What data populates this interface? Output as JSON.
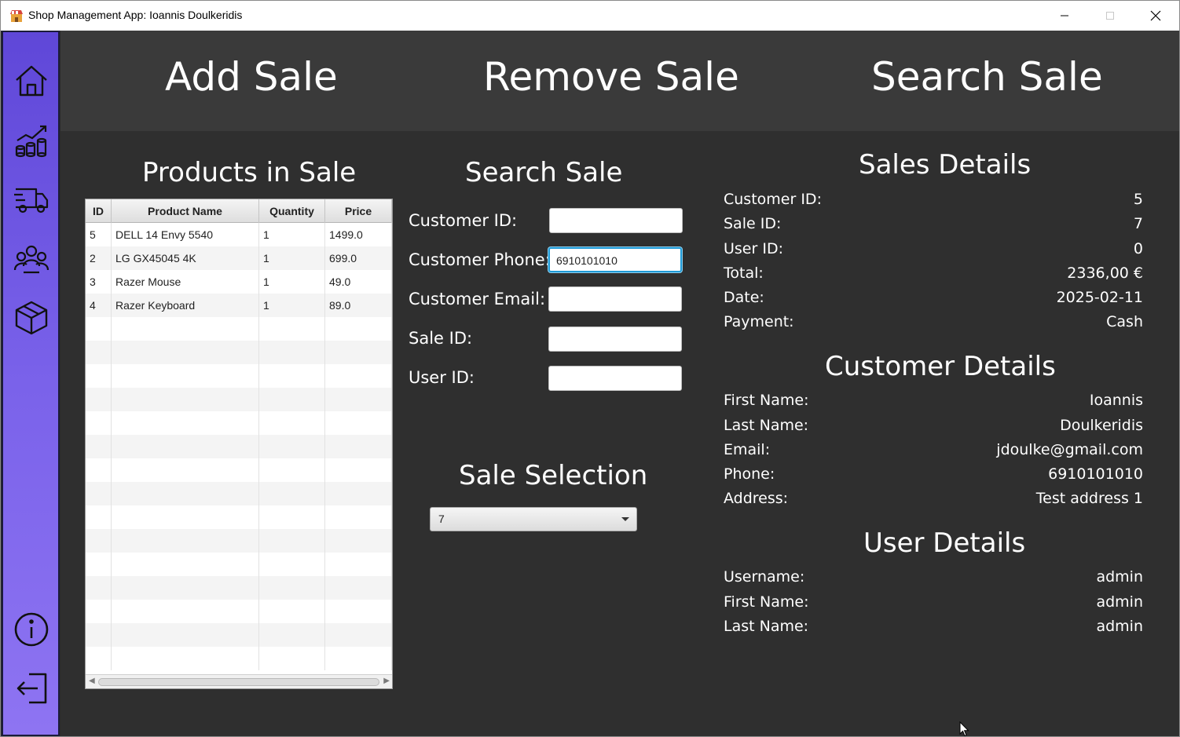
{
  "window": {
    "title": "Shop Management App: Ioannis Doulkeridis"
  },
  "sidebar": {
    "items": [
      {
        "icon": "home-icon"
      },
      {
        "icon": "sales-chart-icon"
      },
      {
        "icon": "delivery-truck-icon"
      },
      {
        "icon": "customers-icon"
      },
      {
        "icon": "products-box-icon"
      },
      {
        "icon": "info-icon"
      },
      {
        "icon": "logout-icon"
      }
    ],
    "accent_top": "#5f47d8",
    "accent_bottom": "#8e74f2"
  },
  "header": {
    "add_sale": "Add Sale",
    "remove_sale": "Remove Sale",
    "search_sale": "Search Sale"
  },
  "products": {
    "title": "Products in Sale",
    "columns": [
      "ID",
      "Product Name",
      "Quantity",
      "Price"
    ],
    "rows": [
      [
        "5",
        "DELL 14 Envy 5540",
        "1",
        "1499.0"
      ],
      [
        "2",
        "LG GX45045 4K",
        "1",
        "699.0"
      ],
      [
        "3",
        "Razer Mouse",
        "1",
        "49.0"
      ],
      [
        "4",
        "Razer Keyboard",
        "1",
        "89.0"
      ]
    ]
  },
  "search": {
    "title": "Search Sale",
    "customer_id_label": "Customer ID:",
    "customer_id_value": "",
    "customer_phone_label": "Customer Phone:",
    "customer_phone_value": "6910101010",
    "customer_email_label": "Customer Email:",
    "customer_email_value": "",
    "sale_id_label": "Sale ID:",
    "sale_id_value": "",
    "user_id_label": "User ID:",
    "user_id_value": ""
  },
  "selection": {
    "title": "Sale Selection",
    "selected": "7"
  },
  "sales_details": {
    "title": "Sales Details",
    "customer_id_label": "Customer ID:",
    "customer_id": "5",
    "sale_id_label": "Sale ID:",
    "sale_id": "7",
    "user_id_label": "User ID:",
    "user_id": "0",
    "total_label": "Total:",
    "total": "2336,00 €",
    "date_label": "Date:",
    "date": "2025-02-11",
    "payment_label": "Payment:",
    "payment": "Cash"
  },
  "customer_details": {
    "title": "Customer Details",
    "first_name_label": "First Name:",
    "first_name": "Ioannis",
    "last_name_label": "Last Name:",
    "last_name": "Doulkeridis",
    "email_label": "Email:",
    "email": "jdoulke@gmail.com",
    "phone_label": "Phone:",
    "phone": "6910101010",
    "address_label": "Address:",
    "address": "Test address 1"
  },
  "user_details": {
    "title": "User Details",
    "username_label": "Username:",
    "username": "admin",
    "first_name_label": "First Name:",
    "first_name": "admin",
    "last_name_label": "Last Name:",
    "last_name": "admin"
  }
}
